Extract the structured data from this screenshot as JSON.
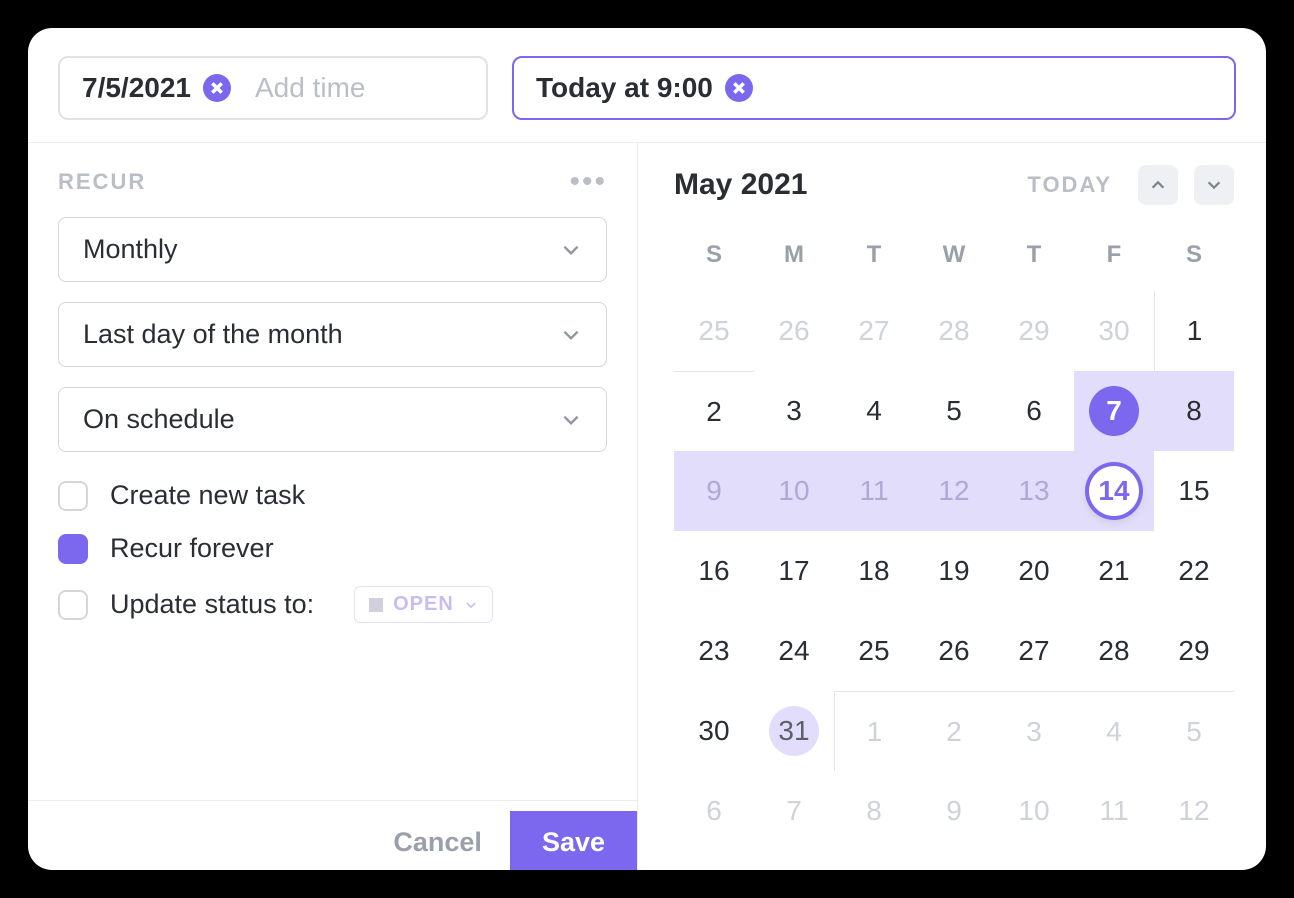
{
  "colors": {
    "accent": "#7b68ee",
    "range_bg": "#e2ddfa"
  },
  "chips": {
    "start": {
      "value": "7/5/2021",
      "add_time_placeholder": "Add time"
    },
    "end": {
      "value": "Today at 9:00"
    }
  },
  "recur": {
    "section_label": "RECUR",
    "dropdowns": {
      "freq": "Monthly",
      "rule": "Last day of the month",
      "timing": "On schedule"
    },
    "checks": {
      "create_new_task": {
        "label": "Create new task",
        "checked": false
      },
      "recur_forever": {
        "label": "Recur forever",
        "checked": true
      },
      "update_status": {
        "label": "Update status to:",
        "checked": false,
        "status_value": "OPEN"
      }
    },
    "footer": {
      "cancel": "Cancel",
      "save": "Save"
    }
  },
  "calendar": {
    "title": "May 2021",
    "today_label": "TODAY",
    "dow": [
      "S",
      "M",
      "T",
      "W",
      "T",
      "F",
      "S"
    ],
    "weeks": [
      [
        {
          "n": 25,
          "out": true
        },
        {
          "n": 26,
          "out": true
        },
        {
          "n": 27,
          "out": true
        },
        {
          "n": 28,
          "out": true
        },
        {
          "n": 29,
          "out": true
        },
        {
          "n": 30,
          "out": true
        },
        {
          "n": 1
        }
      ],
      [
        {
          "n": 2
        },
        {
          "n": 3
        },
        {
          "n": 4
        },
        {
          "n": 5
        },
        {
          "n": 6
        },
        {
          "n": 7,
          "sel": "solid",
          "range": true
        },
        {
          "n": 8,
          "range": true
        }
      ],
      [
        {
          "n": 9,
          "range": true,
          "out": true
        },
        {
          "n": 10,
          "range": true,
          "out": true
        },
        {
          "n": 11,
          "range": true,
          "out": true
        },
        {
          "n": 12,
          "range": true,
          "out": true
        },
        {
          "n": 13,
          "range": true,
          "out": true
        },
        {
          "n": 14,
          "sel": "ring",
          "range": true
        },
        {
          "n": 15
        }
      ],
      [
        {
          "n": 16
        },
        {
          "n": 17
        },
        {
          "n": 18
        },
        {
          "n": 19
        },
        {
          "n": 20
        },
        {
          "n": 21
        },
        {
          "n": 22
        }
      ],
      [
        {
          "n": 23
        },
        {
          "n": 24
        },
        {
          "n": 25
        },
        {
          "n": 26
        },
        {
          "n": 27
        },
        {
          "n": 28
        },
        {
          "n": 29
        }
      ],
      [
        {
          "n": 30
        },
        {
          "n": 31,
          "today": true
        },
        {
          "n": 1,
          "out": true
        },
        {
          "n": 2,
          "out": true
        },
        {
          "n": 3,
          "out": true
        },
        {
          "n": 4,
          "out": true
        },
        {
          "n": 5,
          "out": true
        }
      ],
      [
        {
          "n": 6,
          "out": true
        },
        {
          "n": 7,
          "out": true
        },
        {
          "n": 8,
          "out": true
        },
        {
          "n": 9,
          "out": true
        },
        {
          "n": 10,
          "out": true
        },
        {
          "n": 11,
          "out": true
        },
        {
          "n": 12,
          "out": true
        }
      ]
    ]
  }
}
